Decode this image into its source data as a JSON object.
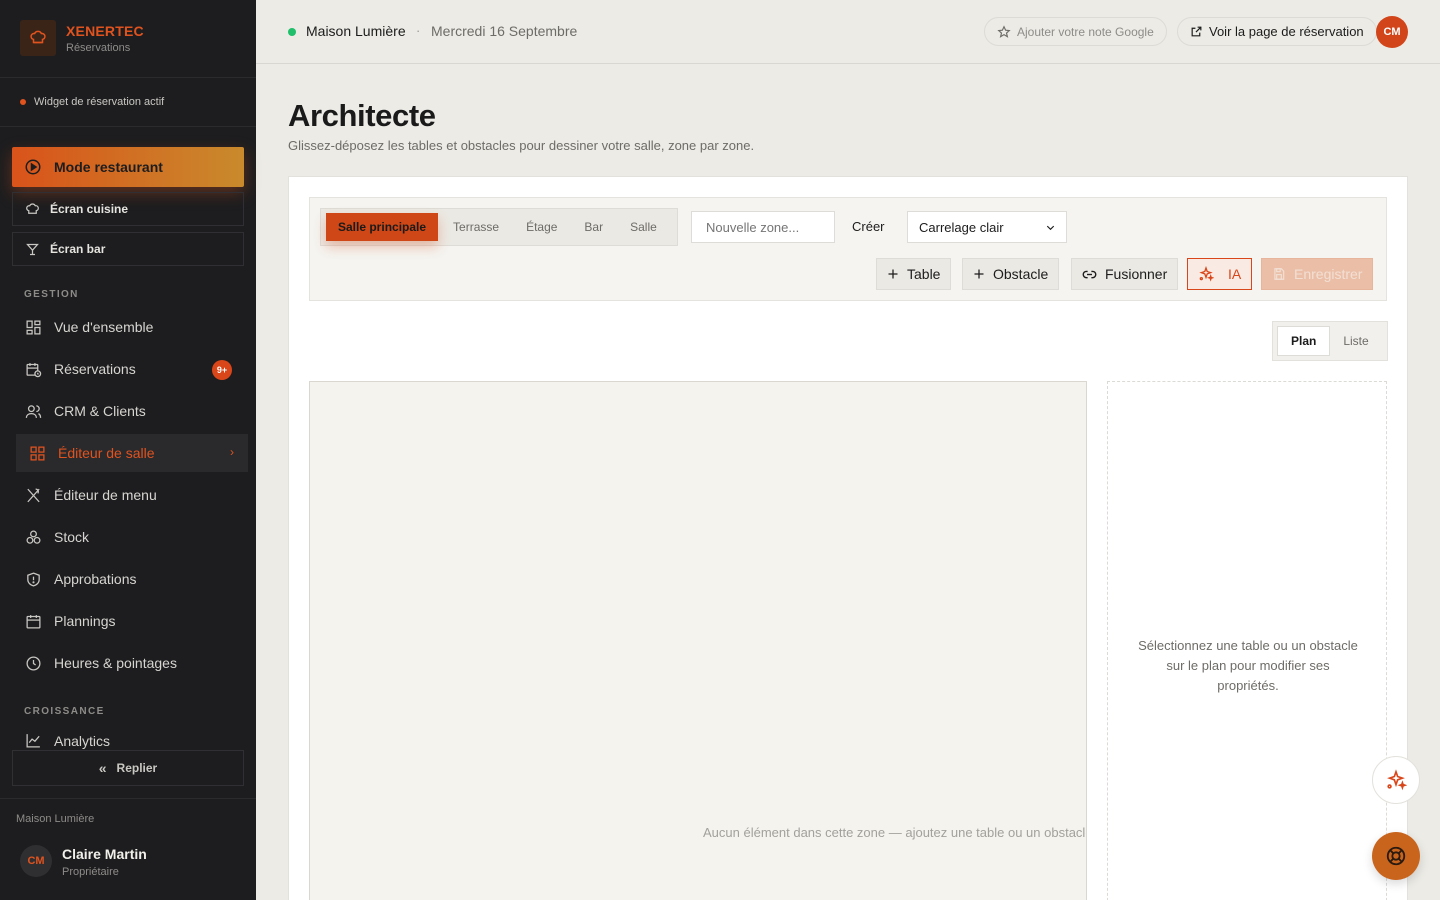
{
  "brand": {
    "name": "XENERTEC",
    "subtitle": "Réservations"
  },
  "widget_status": "Widget de réservation actif",
  "sidebar": {
    "mode_button": "Mode restaurant",
    "quick_links": [
      {
        "label": "Écran cuisine",
        "icon": "chef-hat-icon"
      },
      {
        "label": "Écran bar",
        "icon": "cocktail-glass-icon"
      }
    ],
    "section_gestion": "GESTION",
    "gestion_items": [
      {
        "label": "Vue d'ensemble",
        "icon": "dashboard-icon"
      },
      {
        "label": "Réservations",
        "icon": "calendar-clock-icon",
        "badge": "9+"
      },
      {
        "label": "CRM & Clients",
        "icon": "users-icon"
      },
      {
        "label": "Éditeur de salle",
        "icon": "grid-icon",
        "active": true
      },
      {
        "label": "Éditeur de menu",
        "icon": "utensils-icon"
      },
      {
        "label": "Stock",
        "icon": "boxes-icon"
      },
      {
        "label": "Approbations",
        "icon": "shield-icon"
      },
      {
        "label": "Plannings",
        "icon": "calendar-icon"
      },
      {
        "label": "Heures & pointages",
        "icon": "clock-icon"
      }
    ],
    "section_croissance": "CROISSANCE",
    "croissance_items": [
      {
        "label": "Analytics",
        "icon": "chart-line-icon"
      }
    ],
    "collapse_label": "Replier",
    "footer": {
      "org": "Maison Lumière",
      "initials": "CM",
      "user_name": "Claire Martin",
      "role": "Propriétaire"
    }
  },
  "topbar": {
    "restaurant": "Maison Lumière",
    "separator": "·",
    "date": "Mercredi 16 Septembre",
    "google_label": "Ajouter votre note Google",
    "booking_page_label": "Voir la page de réservation",
    "initials": "CM"
  },
  "page": {
    "title": "Architecte",
    "subtitle": "Glissez-déposez les tables et obstacles pour dessiner votre salle, zone par zone."
  },
  "toolbar": {
    "zones": [
      {
        "label": "Salle principale",
        "active": true
      },
      {
        "label": "Terrasse"
      },
      {
        "label": "Étage"
      },
      {
        "label": "Bar"
      },
      {
        "label": "Salle"
      }
    ],
    "new_zone_placeholder": "Nouvelle zone...",
    "create_label": "Créer",
    "floor_value": "Carrelage clair",
    "add_table": "Table",
    "add_obstacle": "Obstacle",
    "merge": "Fusionner",
    "ai": "IA",
    "save": "Enregistrer"
  },
  "view_toggle": {
    "plan": "Plan",
    "list": "Liste",
    "active": "Plan"
  },
  "canvas": {
    "empty_message": "Aucun élément dans cette zone — ajoutez une table ou un obstacle pour commencer."
  },
  "properties": {
    "empty_message": "Sélectionnez une table ou un obstacle sur le plan pour modifier ses propriétés."
  },
  "colors": {
    "accent": "#d9461a",
    "sidebar_bg": "#1d1d1f",
    "status_green": "#1fbf6b",
    "page_bg": "#ecebe6"
  }
}
